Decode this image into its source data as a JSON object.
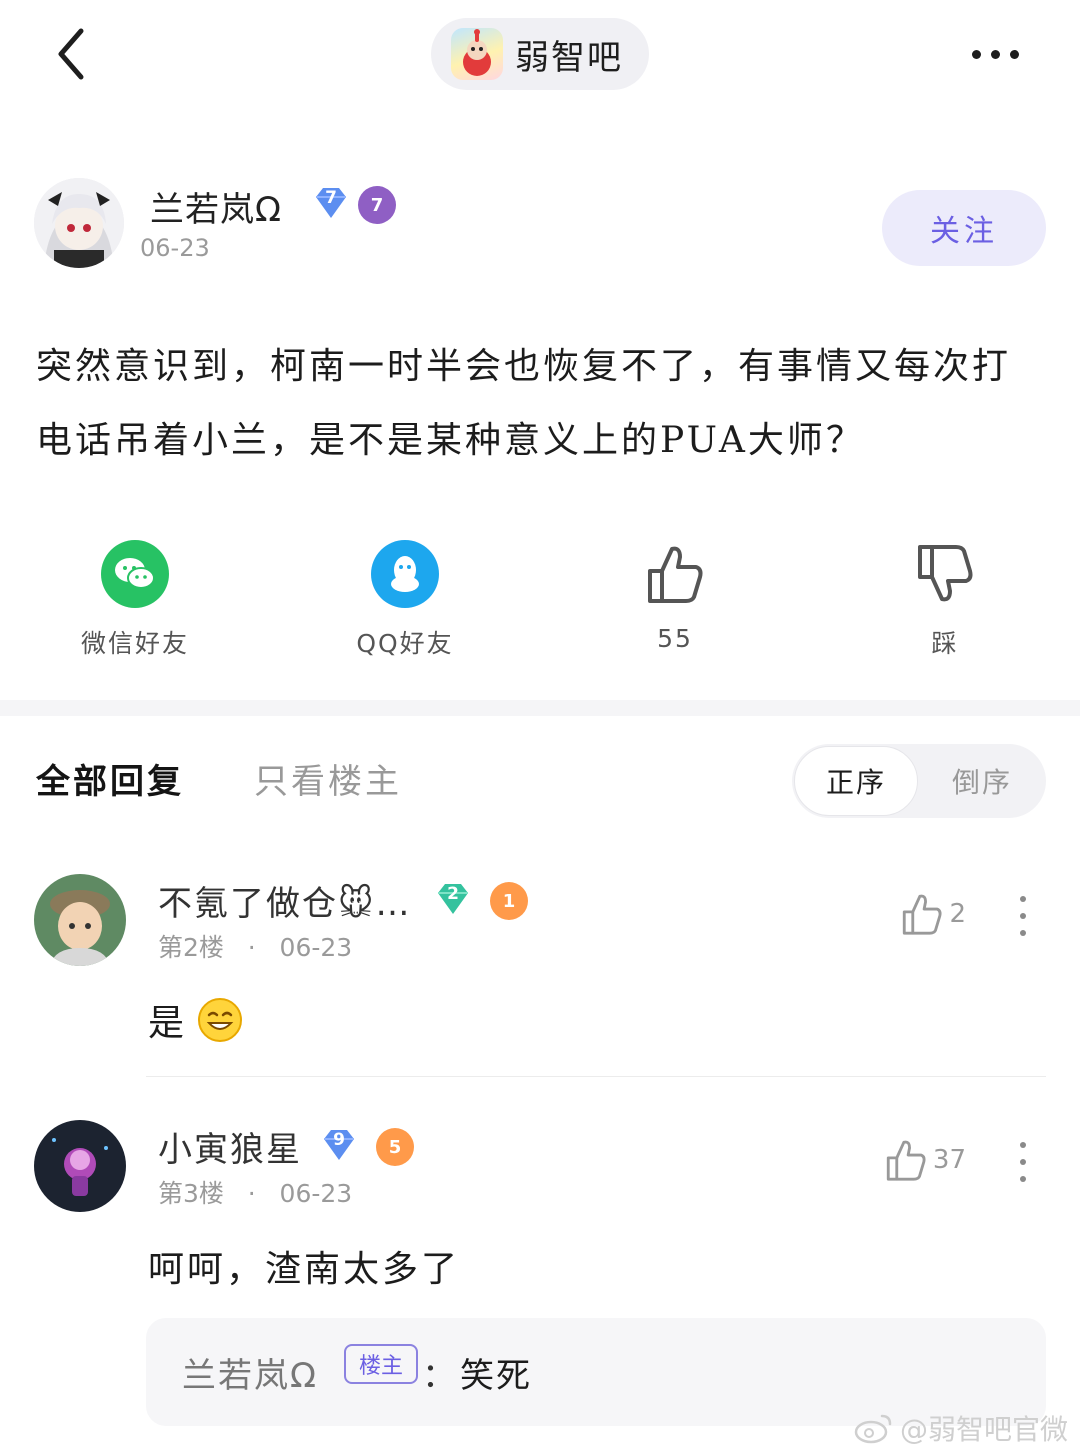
{
  "forum": {
    "name": "弱智吧"
  },
  "post": {
    "author": {
      "name": "兰若岚Ω",
      "badge_gem": "7",
      "badge_level": "7",
      "date": "06-23"
    },
    "follow_label": "关注",
    "body": "突然意识到，柯南一时半会也恢复不了，有事情又每次打电话吊着小兰，是不是某种意义上的PUA大师？"
  },
  "share": {
    "wechat_label": "微信好友",
    "qq_label": "QQ好友",
    "like_count": "55",
    "dislike_label": "踩"
  },
  "tabs": {
    "all_replies": "全部回复",
    "op_only": "只看楼主",
    "sort_asc": "正序",
    "sort_desc": "倒序"
  },
  "replies": [
    {
      "name": "不氪了做仓🐭…",
      "badge_gem": "2",
      "badge_level": "1",
      "floor": "第2楼",
      "date": "06-23",
      "likes": "2",
      "text": "是"
    },
    {
      "name": "小寅狼星",
      "badge_gem": "9",
      "badge_level": "5",
      "floor": "第3楼",
      "date": "06-23",
      "likes": "37",
      "text": "呵呵，渣南太多了",
      "subreply": {
        "author": "兰若岚Ω",
        "tag": "楼主",
        "separator": "：",
        "text": "笑死"
      }
    }
  ],
  "watermark": "@弱智吧官微",
  "colors": {
    "accent": "#6b5fe3",
    "wechat": "#27c264",
    "qq": "#1da7ee",
    "gem_blue": "#5c8ef0",
    "gem_green": "#34c29e",
    "level_purple": "#8f5fc4",
    "level_orange": "#ff9a4a"
  }
}
